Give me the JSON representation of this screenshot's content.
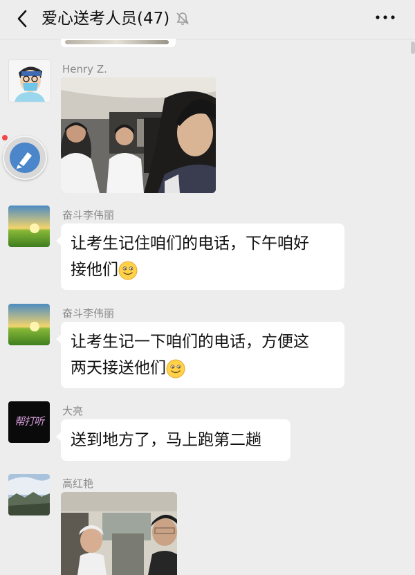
{
  "header": {
    "title": "爱心送考人员(47)",
    "back_icon": "chevron-left-icon",
    "mute_icon": "bell-off-icon",
    "more_icon": "more-dots-icon"
  },
  "messages": [
    {
      "sender": "Henry  Z.",
      "type": "image",
      "avatar": "doctor-cartoon-avatar"
    },
    {
      "sender": "奋斗李伟丽",
      "type": "text",
      "lines": [
        "让考生记住咱们的电话，下午咱好",
        "接他们"
      ],
      "emoji": "smile"
    },
    {
      "sender": "奋斗李伟丽",
      "type": "text",
      "lines": [
        "让考生记一下咱们的电话，方便这",
        "两天接送他们"
      ],
      "emoji": "smile"
    },
    {
      "sender": "大亮",
      "type": "text",
      "lines": [
        "送到地方了，马上跑第二趟"
      ],
      "avatar_text": "帮打听"
    },
    {
      "sender": "高红艳",
      "type": "image"
    }
  ],
  "colors": {
    "background": "#ededed",
    "bubble": "#ffffff",
    "sender": "#888888"
  }
}
